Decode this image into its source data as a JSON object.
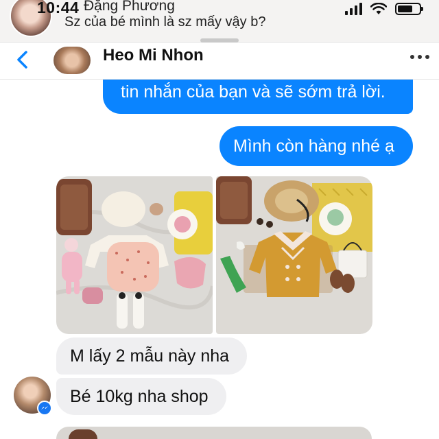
{
  "notification": {
    "time": "10:44",
    "sender": "Đặng Phương",
    "preview": "Sz của bé mình là sz mấy vậy b?",
    "battery_level": 0.7,
    "signal_bars": 4
  },
  "header": {
    "contact_name": "Heo Mi Nhon"
  },
  "messages": {
    "outgoing_auto_reply": "tin nhắn của bạn và sẽ sớm trả lời.",
    "outgoing_stock": "Mình còn hàng nhé ạ",
    "incoming_1": "M lấy 2 mẫu này nha",
    "incoming_2": "Bé 10kg nha shop"
  },
  "colors": {
    "accent": "#0a84ff",
    "incoming_bubble": "#efeff1",
    "messenger_badge": "#1877f2"
  }
}
